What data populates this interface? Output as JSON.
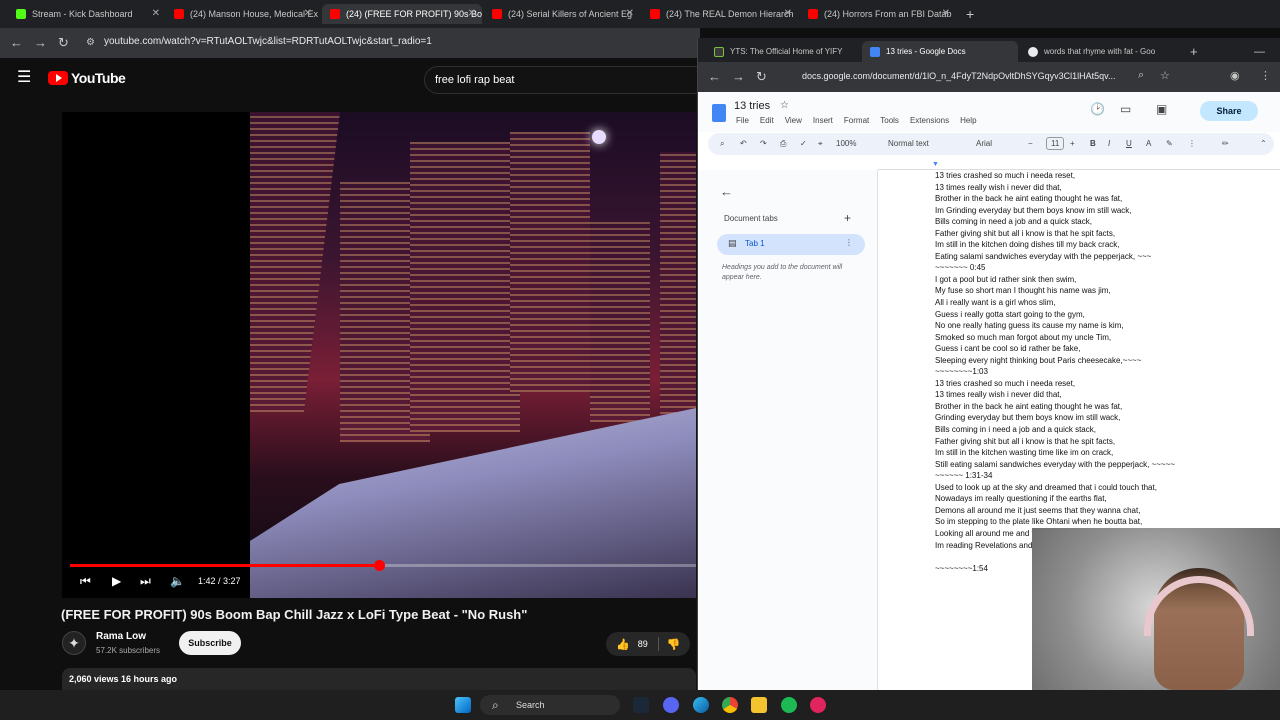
{
  "browser_back": {
    "tabs": [
      {
        "title": "Stream - Kick Dashboard",
        "color": "#53fc18"
      },
      {
        "title": "(24) Manson House, Medical Ex",
        "color": "#ff0000"
      },
      {
        "title": "(24) (FREE FOR PROFIT) 90s Bo",
        "color": "#ff0000"
      },
      {
        "title": "(24) Serial Killers of Ancient Eg",
        "color": "#ff0000"
      },
      {
        "title": "(24) The REAL Demon Hierarch",
        "color": "#ff0000"
      },
      {
        "title": "(24) Horrors From an FBI Datab",
        "color": "#ff0000"
      }
    ],
    "url": "youtube.com/watch?v=RTutAOLTwjc&list=RDRTutAOLTwjc&start_radio=1"
  },
  "youtube": {
    "logo": "YouTube",
    "search_value": "free lofi rap beat",
    "player": {
      "time": "1:42 / 3:27",
      "progress": 0.493
    },
    "video_title": "(FREE FOR PROFIT) 90s Boom Bap Chill Jazz x LoFi Type Beat - \"No Rush\"",
    "channel": {
      "name": "Rama Low",
      "subs": "57.2K subscribers",
      "subscribe_label": "Subscribe"
    },
    "likes": "89",
    "description_meta": "2,060 views  16 hours ago"
  },
  "docs_window": {
    "tabs": [
      {
        "title": "YTS: The Official Home of YIFY",
        "color": "#3a3a3a"
      },
      {
        "title": "13 tries - Google Docs",
        "color": "#4285f4"
      },
      {
        "title": "words that rhyme with fat - Goo",
        "color": "#e8eaed"
      }
    ],
    "url": "docs.google.com/document/d/1lO_n_4FdyT2NdpOvltDhSYGqyv3Cl1lHAt5qv...",
    "doc_title": "13 tries",
    "menus": [
      "File",
      "Edit",
      "View",
      "Insert",
      "Format",
      "Tools",
      "Extensions",
      "Help"
    ],
    "share_label": "Share",
    "toolbar": {
      "zoom": "100%",
      "style": "Normal text",
      "font": "Arial",
      "size": "11"
    },
    "side_panel": {
      "heading": "Document tabs",
      "tab_label": "Tab 1",
      "hint": "Headings you add to the document will appear here."
    },
    "lines": [
      "13 tries crashed so much i needa reset,",
      "13 times really wish i never did that,",
      "Brother in the back he aint eating thought he was fat,",
      "Im Grinding everyday but them boys know im still wack,",
      "Bills coming in need a job and a quick stack,",
      "Father giving shit but all i know is that he spit facts,",
      "Im still in the kitchen doing dishes till my back crack,",
      "Eating salami sandwiches everyday with the pepperjack, ~~~",
      "~~~~~~~ 0:45",
      "I got a pool but id rather sink then swim,",
      "My fuse so short man I thought his name was jim,",
      "All i really want is a girl whos slim,",
      "Guess i really gotta start going to the gym,",
      "No one really hating guess its cause my name is kim,",
      "Smoked so much man forgot about my uncle Tim,",
      "Guess i cant be cool so id rather be fake,",
      "Sleeping every night thinking bout Paris cheesecake,~~~~",
      "~~~~~~~~1:03",
      "13 tries crashed so much i needa reset,",
      "13 times really wish i never did that,",
      "Brother in the back he aint eating thought he was fat,",
      "Grinding everyday but them boys know im still wack,",
      "Bills coming in i need a job and a quick stack,",
      "Father giving shit but all i know is that he spit facts,",
      "Im still in the kitchen wasting time like im on crack,",
      "Still eating salami sandwiches everyday with the pepperjack, ~~~~~",
      "~~~~~~ 1:31-34",
      "Used to look up at the sky and dreamed that i could touch that,",
      "Nowadays im really questioning if the earths flat,",
      "Demons all around me it just seems that they wanna chat,",
      "So im stepping to the plate like Ohtani when he boutta bat,",
      "Looking all around me and these people dont know how to act,",
      "Im reading Revelations and thank God spoke back",
      "",
      "~~~~~~~~1:54"
    ]
  },
  "taskbar": {
    "search_label": "Search"
  }
}
